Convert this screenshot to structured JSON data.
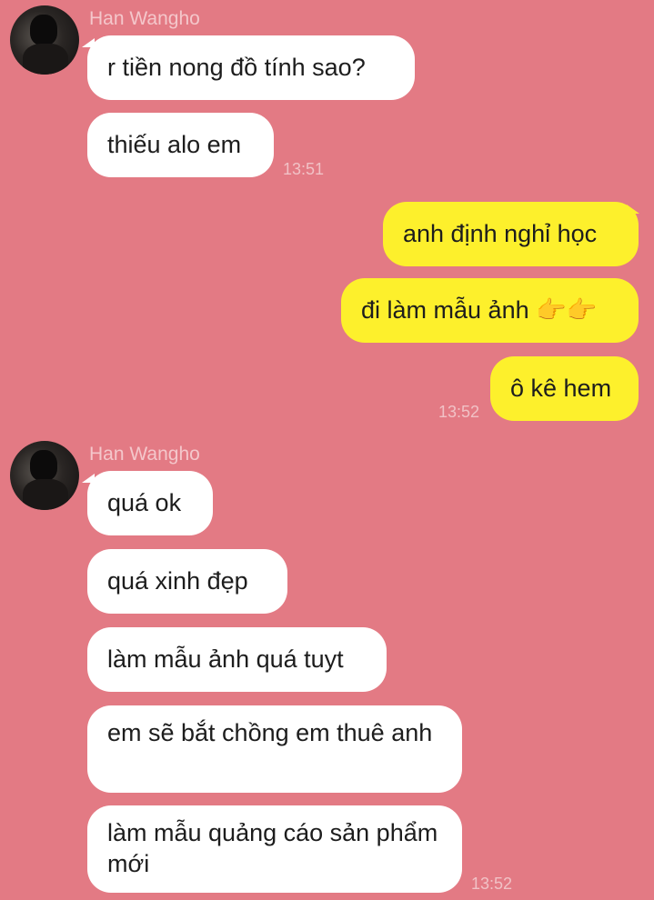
{
  "sender_name": "Han Wangho",
  "avatar_icon": "user-avatar",
  "colors": {
    "background": "#e37a84",
    "incoming_bubble": "#ffffff",
    "outgoing_bubble": "#fdf02c"
  },
  "group1": {
    "name": "Han Wangho",
    "messages": [
      "r tiền nong đồ tính sao?",
      "thiếu alo em"
    ],
    "time": "13:51"
  },
  "outgoing": {
    "messages": [
      "anh định nghỉ học",
      "đi làm mẫu ảnh 👉👉",
      "ô kê hem"
    ],
    "time": "13:52"
  },
  "group2": {
    "name": "Han Wangho",
    "messages": [
      "quá ok",
      "quá xinh đẹp",
      "làm mẫu ảnh quá tuyt",
      "em sẽ bắt chồng em thuê anh",
      "làm mẫu quảng cáo sản phẩm mới"
    ],
    "time": "13:52"
  }
}
